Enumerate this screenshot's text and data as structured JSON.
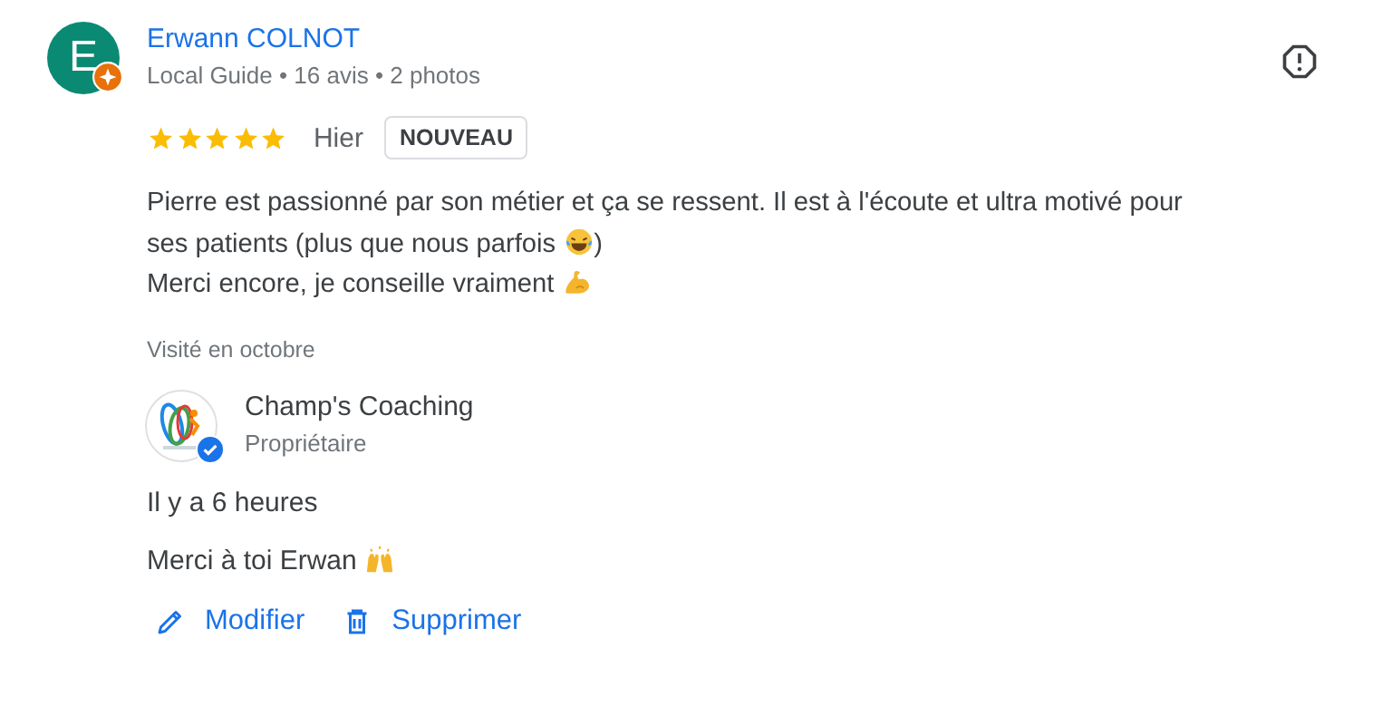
{
  "review": {
    "author": {
      "initial": "E",
      "name": "Erwann COLNOT",
      "meta": "Local Guide • 16 avis • 2 photos",
      "local_guide": true
    },
    "stars": 5,
    "date": "Hier",
    "badge": "NOUVEAU",
    "body": [
      {
        "kind": "text",
        "text": "Pierre est passionné par son métier et ça se ressent. Il est à l'écoute et ultra motivé pour"
      },
      {
        "kind": "break"
      },
      {
        "kind": "text",
        "text": "ses patients (plus que nous parfois "
      },
      {
        "kind": "laughing"
      },
      {
        "kind": "text",
        "text": ")"
      },
      {
        "kind": "break"
      },
      {
        "kind": "text",
        "text": "Merci encore, je conseille vraiment "
      },
      {
        "kind": "muscle"
      }
    ],
    "visited": "Visité en octobre"
  },
  "reply": {
    "owner": {
      "name": "Champ's Coaching",
      "role": "Propriétaire",
      "verified": true
    },
    "time": "Il y a 6 heures",
    "body": [
      {
        "kind": "text",
        "text": "Merci à toi Erwan "
      },
      {
        "kind": "hands"
      }
    ],
    "actions": [
      {
        "kind": "edit",
        "label": "Modifier"
      },
      {
        "kind": "delete",
        "label": "Supprimer"
      }
    ]
  }
}
